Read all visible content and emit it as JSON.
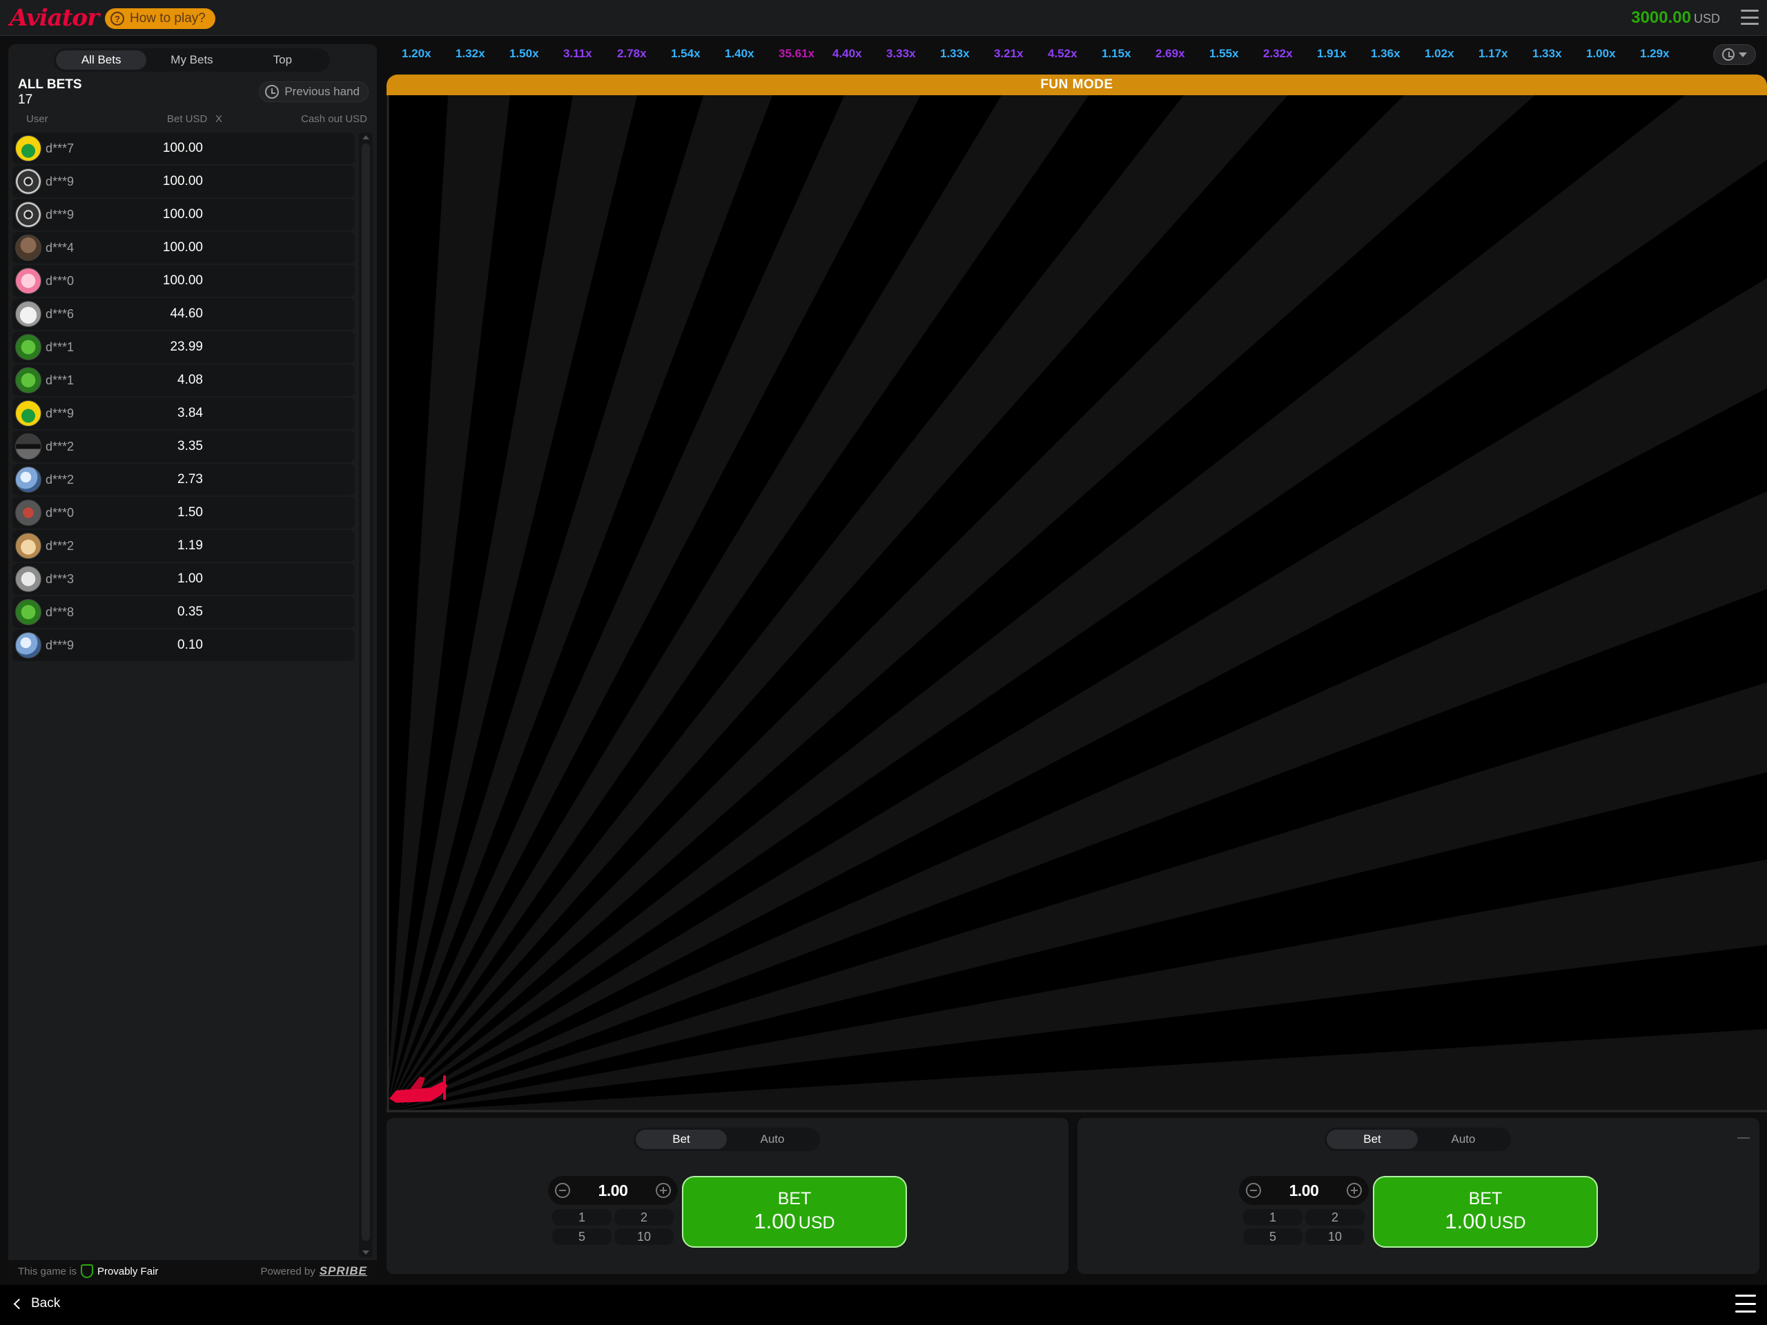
{
  "header": {
    "logo": "Aviator",
    "how_to_play": "How to play?",
    "balance": "3000.00",
    "currency": "USD"
  },
  "bets_panel": {
    "tabs": [
      "All Bets",
      "My Bets",
      "Top"
    ],
    "active_tab": "All Bets",
    "title": "ALL BETS",
    "count": "17",
    "previous_hand": "Previous hand",
    "columns": {
      "user": "User",
      "bet": "Bet USD",
      "x": "X",
      "cashout": "Cash out USD"
    },
    "rows": [
      {
        "user": "d***7",
        "bet": "100.00",
        "avatar": "yellow-green-a"
      },
      {
        "user": "d***9",
        "bet": "100.00",
        "avatar": "steering-wheel"
      },
      {
        "user": "d***9",
        "bet": "100.00",
        "avatar": "steering-wheel"
      },
      {
        "user": "d***4",
        "bet": "100.00",
        "avatar": "cat-photo"
      },
      {
        "user": "d***0",
        "bet": "100.00",
        "avatar": "pink-face"
      },
      {
        "user": "d***6",
        "bet": "44.60",
        "avatar": "white-cat"
      },
      {
        "user": "d***1",
        "bet": "23.99",
        "avatar": "clover"
      },
      {
        "user": "d***1",
        "bet": "4.08",
        "avatar": "clover"
      },
      {
        "user": "d***9",
        "bet": "3.84",
        "avatar": "yellow-green-a"
      },
      {
        "user": "d***2",
        "bet": "3.35",
        "avatar": "sunglasses"
      },
      {
        "user": "d***2",
        "bet": "2.73",
        "avatar": "blue-crystal"
      },
      {
        "user": "d***0",
        "bet": "1.50",
        "avatar": "red-robot"
      },
      {
        "user": "d***2",
        "bet": "1.19",
        "avatar": "dog"
      },
      {
        "user": "d***3",
        "bet": "1.00",
        "avatar": "bird"
      },
      {
        "user": "d***8",
        "bet": "0.35",
        "avatar": "clover"
      },
      {
        "user": "d***9",
        "bet": "0.10",
        "avatar": "blue-crystal"
      }
    ],
    "footer": {
      "prefix": "This game is",
      "provably_fair": "Provably Fair",
      "powered_by": "Powered by",
      "brand": "SPRIBE"
    }
  },
  "multipliers": [
    {
      "v": "1.20x",
      "c": "#34b4ff"
    },
    {
      "v": "1.32x",
      "c": "#34b4ff"
    },
    {
      "v": "1.50x",
      "c": "#34b4ff"
    },
    {
      "v": "3.11x",
      "c": "#913ef8"
    },
    {
      "v": "2.78x",
      "c": "#913ef8"
    },
    {
      "v": "1.54x",
      "c": "#34b4ff"
    },
    {
      "v": "1.40x",
      "c": "#34b4ff"
    },
    {
      "v": "35.61x",
      "c": "#c017b4"
    },
    {
      "v": "4.40x",
      "c": "#913ef8"
    },
    {
      "v": "3.33x",
      "c": "#913ef8"
    },
    {
      "v": "1.33x",
      "c": "#34b4ff"
    },
    {
      "v": "3.21x",
      "c": "#913ef8"
    },
    {
      "v": "4.52x",
      "c": "#913ef8"
    },
    {
      "v": "1.15x",
      "c": "#34b4ff"
    },
    {
      "v": "2.69x",
      "c": "#913ef8"
    },
    {
      "v": "1.55x",
      "c": "#34b4ff"
    },
    {
      "v": "2.32x",
      "c": "#913ef8"
    },
    {
      "v": "1.91x",
      "c": "#34b4ff"
    },
    {
      "v": "1.36x",
      "c": "#34b4ff"
    },
    {
      "v": "1.02x",
      "c": "#34b4ff"
    },
    {
      "v": "1.17x",
      "c": "#34b4ff"
    },
    {
      "v": "1.33x",
      "c": "#34b4ff"
    },
    {
      "v": "1.00x",
      "c": "#34b4ff"
    },
    {
      "v": "1.29x",
      "c": "#34b4ff"
    }
  ],
  "game": {
    "banner": "FUN MODE"
  },
  "bet_panels": [
    {
      "tabs": [
        "Bet",
        "Auto"
      ],
      "amount": "1.00",
      "quick": [
        "1",
        "2",
        "5",
        "10"
      ],
      "button_label": "BET",
      "button_amount": "1.00",
      "button_currency": "USD"
    },
    {
      "tabs": [
        "Bet",
        "Auto"
      ],
      "amount": "1.00",
      "quick": [
        "1",
        "2",
        "5",
        "10"
      ],
      "button_label": "BET",
      "button_amount": "1.00",
      "button_currency": "USD"
    }
  ],
  "bottom": {
    "back": "Back"
  },
  "colors": {
    "brand_red": "#e50539",
    "bet_green": "#28a909",
    "fun_mode": "#d38c0b"
  }
}
